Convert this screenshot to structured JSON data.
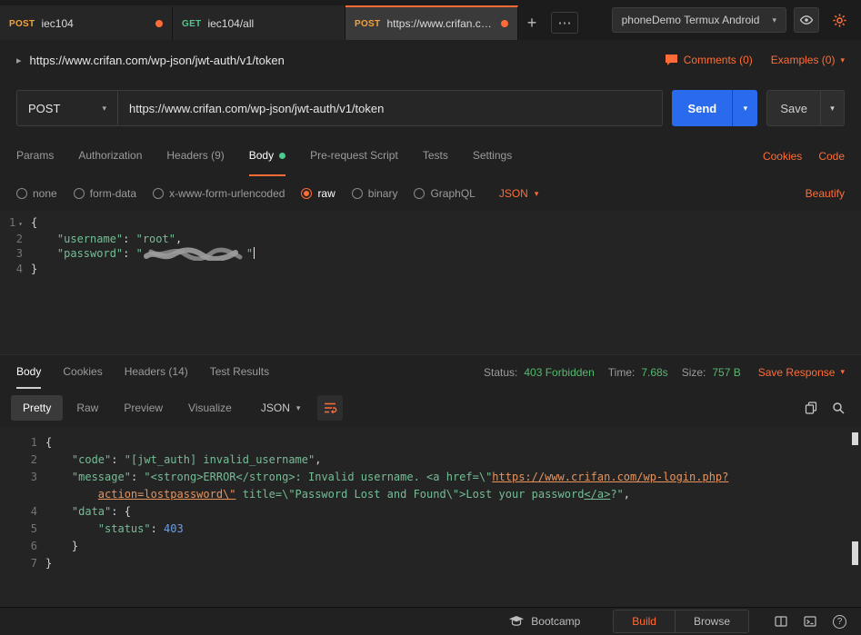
{
  "icons": {
    "chevron_down": "▾",
    "breadcrumb_caret": "▸",
    "plus": "+",
    "more": "⋯",
    "help": "?"
  },
  "colors": {
    "accent_orange": "#ff6c37",
    "send_blue": "#2a6bed",
    "status_green": "#55b96f",
    "string_green": "#74bd95",
    "number_blue": "#6d9ee3",
    "link_orange": "#e8935c"
  },
  "tabbar": {
    "tabs": [
      {
        "method": "POST",
        "title": "iec104",
        "dirty": true,
        "active": false
      },
      {
        "method": "GET",
        "title": "iec104/all",
        "dirty": false,
        "active": false
      },
      {
        "method": "POST",
        "title": "https://www.crifan.com...",
        "dirty": true,
        "active": true
      }
    ],
    "environment": "phoneDemo Termux Android"
  },
  "request_header": {
    "title": "https://www.crifan.com/wp-json/jwt-auth/v1/token",
    "comments": "Comments (0)",
    "examples": "Examples (0)"
  },
  "url_bar": {
    "method": "POST",
    "url": "https://www.crifan.com/wp-json/jwt-auth/v1/token",
    "send": "Send",
    "save": "Save"
  },
  "request_tabs": {
    "items": [
      {
        "label": "Params"
      },
      {
        "label": "Authorization"
      },
      {
        "label": "Headers (9)"
      },
      {
        "label": "Body",
        "active": true,
        "dot": true
      },
      {
        "label": "Pre-request Script"
      },
      {
        "label": "Tests"
      },
      {
        "label": "Settings"
      }
    ],
    "cookies": "Cookies",
    "code": "Code"
  },
  "body_mode": {
    "options": [
      {
        "label": "none"
      },
      {
        "label": "form-data"
      },
      {
        "label": "x-www-form-urlencoded"
      },
      {
        "label": "raw",
        "selected": true
      },
      {
        "label": "binary"
      },
      {
        "label": "GraphQL"
      }
    ],
    "language": "JSON",
    "beautify": "Beautify"
  },
  "request_body": {
    "lines": [
      {
        "n": "1",
        "fold": true,
        "segs": [
          {
            "t": "{",
            "c": "p"
          }
        ]
      },
      {
        "n": "2",
        "segs": [
          {
            "t": "    ",
            "c": "p"
          },
          {
            "t": "\"username\"",
            "c": "s"
          },
          {
            "t": ": ",
            "c": "p"
          },
          {
            "t": "\"root\"",
            "c": "s"
          },
          {
            "t": ",",
            "c": "p"
          }
        ]
      },
      {
        "n": "3",
        "segs": [
          {
            "t": "    ",
            "c": "p"
          },
          {
            "t": "\"password\"",
            "c": "s"
          },
          {
            "t": ": ",
            "c": "p"
          },
          {
            "t": "\"",
            "c": "s"
          },
          {
            "c": "scribble"
          },
          {
            "t": "\"",
            "c": "s"
          },
          {
            "c": "caret"
          }
        ]
      },
      {
        "n": "4",
        "segs": [
          {
            "t": "}",
            "c": "p"
          }
        ]
      }
    ]
  },
  "response_meta": {
    "tabs": [
      {
        "label": "Body",
        "active": true
      },
      {
        "label": "Cookies"
      },
      {
        "label": "Headers (14)"
      },
      {
        "label": "Test Results"
      }
    ],
    "status_label": "Status:",
    "status_value": "403 Forbidden",
    "time_label": "Time:",
    "time_value": "7.68s",
    "size_label": "Size:",
    "size_value": "757 B",
    "save_response": "Save Response"
  },
  "response_toolbar": {
    "views": [
      {
        "label": "Pretty",
        "active": true
      },
      {
        "label": "Raw"
      },
      {
        "label": "Preview"
      },
      {
        "label": "Visualize"
      }
    ],
    "language": "JSON"
  },
  "response_body": {
    "rows": [
      {
        "n": "1",
        "segs": [
          {
            "t": "{",
            "c": "p"
          }
        ]
      },
      {
        "n": "2",
        "segs": [
          {
            "t": "    ",
            "c": "p"
          },
          {
            "t": "\"code\"",
            "c": "s"
          },
          {
            "t": ": ",
            "c": "p"
          },
          {
            "t": "\"[jwt_auth] invalid_username\"",
            "c": "s"
          },
          {
            "t": ",",
            "c": "p"
          }
        ]
      },
      {
        "n": "3",
        "segs": [
          {
            "t": "    ",
            "c": "p"
          },
          {
            "t": "\"message\"",
            "c": "s"
          },
          {
            "t": ": ",
            "c": "p"
          },
          {
            "t": "\"<strong>ERROR</strong>: Invalid username. <a href=\\\"",
            "c": "s"
          },
          {
            "t": "https://www.crifan.com/wp-login.php?",
            "c": "link"
          }
        ]
      },
      {
        "n": "",
        "segs": [
          {
            "t": "        ",
            "c": "p"
          },
          {
            "t": "action=lostpassword\\\"",
            "c": "link"
          },
          {
            "t": " title=\\\"Password Lost and Found\\\">Lost your password",
            "c": "s"
          },
          {
            "t": "</a>",
            "c": "s u"
          },
          {
            "t": "?\"",
            "c": "s"
          },
          {
            "t": ",",
            "c": "p"
          }
        ]
      },
      {
        "n": "4",
        "segs": [
          {
            "t": "    ",
            "c": "p"
          },
          {
            "t": "\"data\"",
            "c": "s"
          },
          {
            "t": ": ",
            "c": "p"
          },
          {
            "t": "{",
            "c": "p"
          }
        ]
      },
      {
        "n": "5",
        "segs": [
          {
            "t": "        ",
            "c": "p"
          },
          {
            "t": "\"status\"",
            "c": "s"
          },
          {
            "t": ": ",
            "c": "p"
          },
          {
            "t": "403",
            "c": "num"
          }
        ]
      },
      {
        "n": "6",
        "segs": [
          {
            "t": "    }",
            "c": "p"
          }
        ]
      },
      {
        "n": "7",
        "segs": [
          {
            "t": "}",
            "c": "p"
          }
        ]
      }
    ]
  },
  "status_bar": {
    "bootcamp": "Bootcamp",
    "build": "Build",
    "browse": "Browse"
  }
}
